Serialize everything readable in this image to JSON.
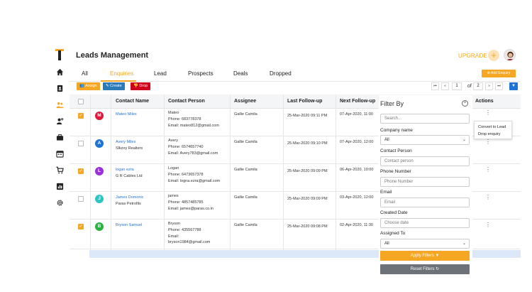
{
  "app": {
    "title": "Leads Management",
    "upgrade_label": "UPGRADE",
    "plus_label": "+"
  },
  "tabs": [
    "All",
    "Enquiries",
    "Lead",
    "Prospects",
    "Deals",
    "Dropped"
  ],
  "active_tab": "Enquiries",
  "toolbar": {
    "assign_label": "Assign",
    "create_label": "Create",
    "drop_label": "Drop",
    "add_enquiry_label": "Add Enquiry"
  },
  "pagination": {
    "first": "⏮",
    "prev": "«",
    "current": "1",
    "of": "of",
    "total": "2",
    "next": "»",
    "last": "⏭"
  },
  "table": {
    "headers": [
      "Contact Name",
      "Contact Person",
      "Assignee",
      "Last Follow-up",
      "Next Follow-up",
      "Actions"
    ],
    "rows": [
      {
        "checked": true,
        "initial": "M",
        "color": "#e0173a",
        "name": "Mateo Miles",
        "company": "",
        "person": "Mateo",
        "phone": "Phone: 683778378",
        "email": "Email: mateo812@gmail.com",
        "assignee": "Gallie Camila",
        "last": "25-Mar-2020 09:11 PM",
        "next": "07-Apr-2020, 11:00"
      },
      {
        "checked": false,
        "initial": "A",
        "color": "#1e73d8",
        "name": "Avery Miles",
        "company": "Slkzoy Realters",
        "person": "Avery",
        "phone": "Phone: 6574657740",
        "email": "Email: Avery783@gmail.com",
        "assignee": "Gallie Camila",
        "last": "25-Mar-2020 09:10 PM",
        "next": "07-Apr-2020, 12:00"
      },
      {
        "checked": true,
        "initial": "L",
        "color": "#9b30d9",
        "name": "logan ezra",
        "company": "G R Cables Ltd",
        "person": "Logan",
        "phone": "Phone: 6473657378",
        "email": "Email: logna.ezra@gmail.com",
        "assignee": "Gallie Camila",
        "last": "25-Mar-2020 09:09 PM",
        "next": "06-Apr-2020, 10:00"
      },
      {
        "checked": false,
        "initial": "J",
        "color": "#2ec4c4",
        "name": "James Domonic",
        "company": "Paras Petrofils",
        "person": "james",
        "phone": "Phone: 4857485785",
        "email": "Email: james@paras.co.in",
        "assignee": "Gallie Camila",
        "last": "25-Mar-2020 09:09 PM",
        "next": "03-Apr-2020, 12:00"
      },
      {
        "checked": true,
        "initial": "B",
        "color": "#27b43e",
        "name": "Bryson Samuel",
        "company": "",
        "person": "Bryson",
        "phone": "Phone: 435567788",
        "email": "Email:",
        "email2": "bryson1984@gmail.com",
        "assignee": "Gallie Camila",
        "last": "25-Mar-2020 09:08 PM",
        "next": "02-Apr-2020, 11:30"
      }
    ]
  },
  "context_menu": [
    "Convert to Lead",
    "Drop enquiry"
  ],
  "filter": {
    "title": "Filter By",
    "search_placeholder": "Search...",
    "company_label": "Company name",
    "company_value": "All",
    "contact_label": "Contact Person",
    "contact_placeholder": "Contact person",
    "phone_label": "Phone Number",
    "phone_placeholder": "Phone Number",
    "email_label": "Email",
    "email_placeholder": "Email",
    "created_label": "Created Date",
    "created_placeholder": "Choose date",
    "assigned_label": "Assigned To",
    "assigned_value": "All",
    "apply_label": "Apply Filters",
    "reset_label": "Reset Filters"
  },
  "colors": {
    "accent": "#f5a623",
    "primary": "#1e73d8",
    "danger": "#d0021b"
  }
}
